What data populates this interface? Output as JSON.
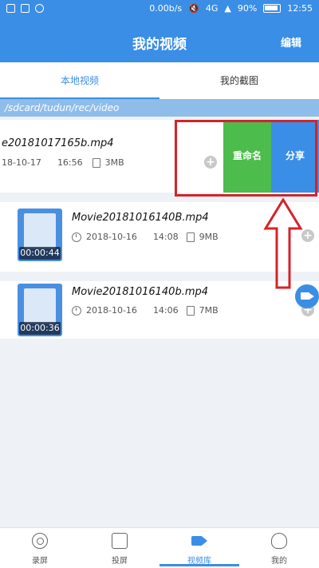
{
  "status_bar": {
    "network_speed": "0.00b/s",
    "network_type": "4G",
    "battery": "90%",
    "time": "12:55"
  },
  "header": {
    "title": "我的视频",
    "edit_label": "编辑"
  },
  "tabs": [
    {
      "label": "本地视频",
      "active": true
    },
    {
      "label": "我的截图",
      "active": false
    }
  ],
  "path": "/sdcard/tudun/rec/video",
  "videos": [
    {
      "name": "e20181017165b.mp4",
      "date": "18-10-17",
      "time": "16:56",
      "size": "3MB",
      "duration": ""
    },
    {
      "name": "Movie20181016140B.mp4",
      "date": "2018-10-16",
      "time": "14:08",
      "size": "9MB",
      "duration": "00:00:44"
    },
    {
      "name": "Movie20181016140b.mp4",
      "date": "2018-10-16",
      "time": "14:06",
      "size": "7MB",
      "duration": "00:00:36"
    }
  ],
  "swipe_actions": {
    "rename": "重命名",
    "share": "分享"
  },
  "bottom_nav": [
    {
      "label": "录屏",
      "icon": "record-icon"
    },
    {
      "label": "投屏",
      "icon": "cast-icon"
    },
    {
      "label": "视频库",
      "icon": "video-library-icon",
      "active": true
    },
    {
      "label": "我的",
      "icon": "profile-icon"
    }
  ],
  "colors": {
    "primary": "#3a8ee6",
    "rename": "#4cbc4c",
    "annotation": "#d4232a"
  }
}
